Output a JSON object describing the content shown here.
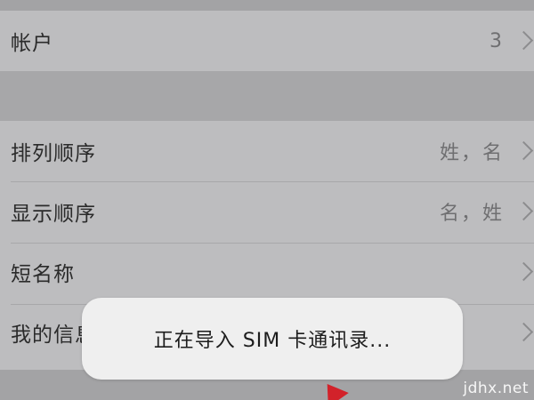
{
  "settings": {
    "accounts": {
      "label": "帐户",
      "value": "3"
    },
    "sort_order": {
      "label": "排列顺序",
      "value": "姓，名"
    },
    "display_order": {
      "label": "显示顺序",
      "value": "名，姓"
    },
    "short_name": {
      "label": "短名称"
    },
    "my_info": {
      "label": "我的信息"
    }
  },
  "toast": {
    "message": "正在导入 SIM 卡通讯录..."
  },
  "watermark": {
    "text": "jdhx.net"
  },
  "colors": {
    "row_bg": "#bdbdbf",
    "toast_bg": "#efefef",
    "arrow": "#d2222a"
  }
}
